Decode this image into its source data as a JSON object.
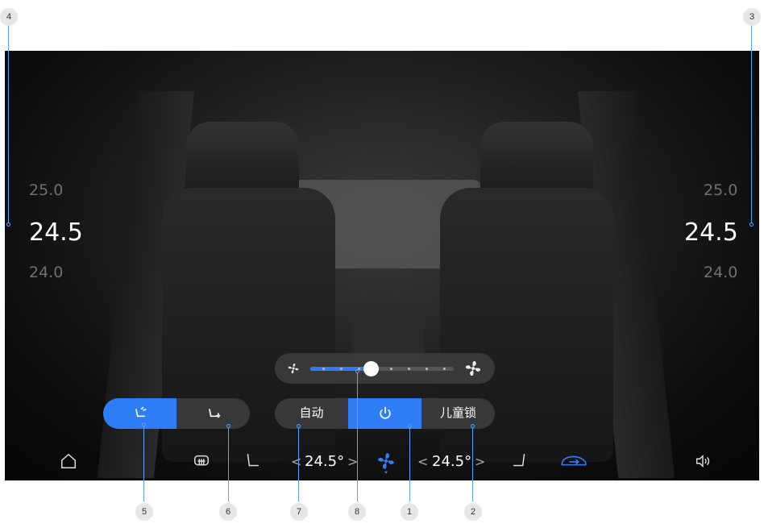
{
  "callouts": [
    "4",
    "3",
    "5",
    "6",
    "7",
    "8",
    "1",
    "2"
  ],
  "left_temps": {
    "above": "25.0",
    "current": "24.5",
    "below": "24.0"
  },
  "right_temps": {
    "above": "25.0",
    "current": "24.5",
    "below": "24.0"
  },
  "fan": {
    "level_fraction": 0.42,
    "low_icon": "fan-small-icon",
    "high_icon": "fan-large-icon"
  },
  "seat_mode": {
    "left_icon": "seat-airflow-upper-icon",
    "right_icon": "seat-airflow-lower-icon",
    "active": "left"
  },
  "controls": {
    "auto_label": "自动",
    "power_icon": "power-icon",
    "child_lock_label": "儿童锁",
    "active": "power"
  },
  "bottom_bar": {
    "left_temp": "24.5°",
    "right_temp": "24.5°",
    "left_prev": "<",
    "left_next": ">",
    "right_prev": "<",
    "right_next": ">",
    "icons": [
      "home-icon",
      "rear-defrost-icon",
      "seat-left-icon",
      "fan-icon",
      "seat-right-icon",
      "car-airflow-icon",
      "volume-icon"
    ]
  },
  "colors": {
    "accent": "#2f7df6",
    "leader": "#5aa0ff"
  }
}
